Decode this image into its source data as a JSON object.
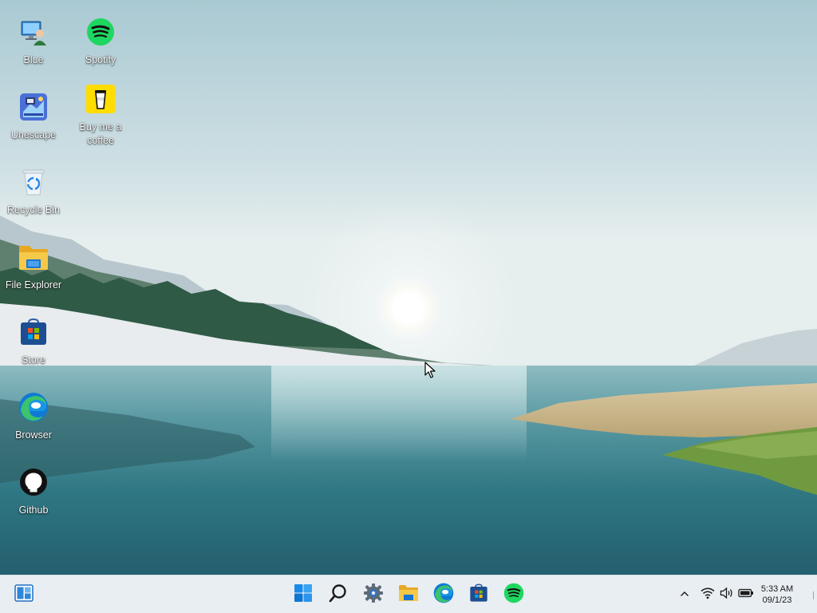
{
  "desktop": {
    "icons": [
      {
        "label": "Blue",
        "icon": "user-computer-icon"
      },
      {
        "label": "Spotify",
        "icon": "spotify-icon"
      },
      {
        "label": "Unescape",
        "icon": "unescape-app-icon"
      },
      {
        "label": "Buy me a coffee",
        "icon": "coffee-cup-icon"
      },
      {
        "label": "Recycle Bin",
        "icon": "recycle-bin-icon"
      },
      {
        "label": "File Explorer",
        "icon": "folder-icon"
      },
      {
        "label": "Store",
        "icon": "store-icon"
      },
      {
        "label": "Browser",
        "icon": "edge-browser-icon"
      },
      {
        "label": "Github",
        "icon": "github-icon"
      }
    ]
  },
  "taskbar": {
    "widgets_icon": "widgets-icon",
    "pinned": [
      {
        "name": "start",
        "icon": "windows-start-icon"
      },
      {
        "name": "search",
        "icon": "search-icon"
      },
      {
        "name": "settings",
        "icon": "gear-icon"
      },
      {
        "name": "file-explorer",
        "icon": "folder-icon"
      },
      {
        "name": "browser",
        "icon": "edge-browser-icon"
      },
      {
        "name": "store",
        "icon": "store-icon"
      },
      {
        "name": "spotify",
        "icon": "spotify-icon"
      }
    ],
    "tray": {
      "chevron_icon": "chevron-up-icon",
      "wifi_icon": "wifi-icon",
      "volume_icon": "volume-icon",
      "battery_icon": "battery-icon"
    },
    "clock": {
      "time": "5:33 AM",
      "date": "09/1/23"
    }
  },
  "colors": {
    "taskbar_bg": "#e9eef3",
    "spotify_green": "#1ed760",
    "windows_blue": "#0a7fd9",
    "folder_yellow": "#f7c948"
  }
}
